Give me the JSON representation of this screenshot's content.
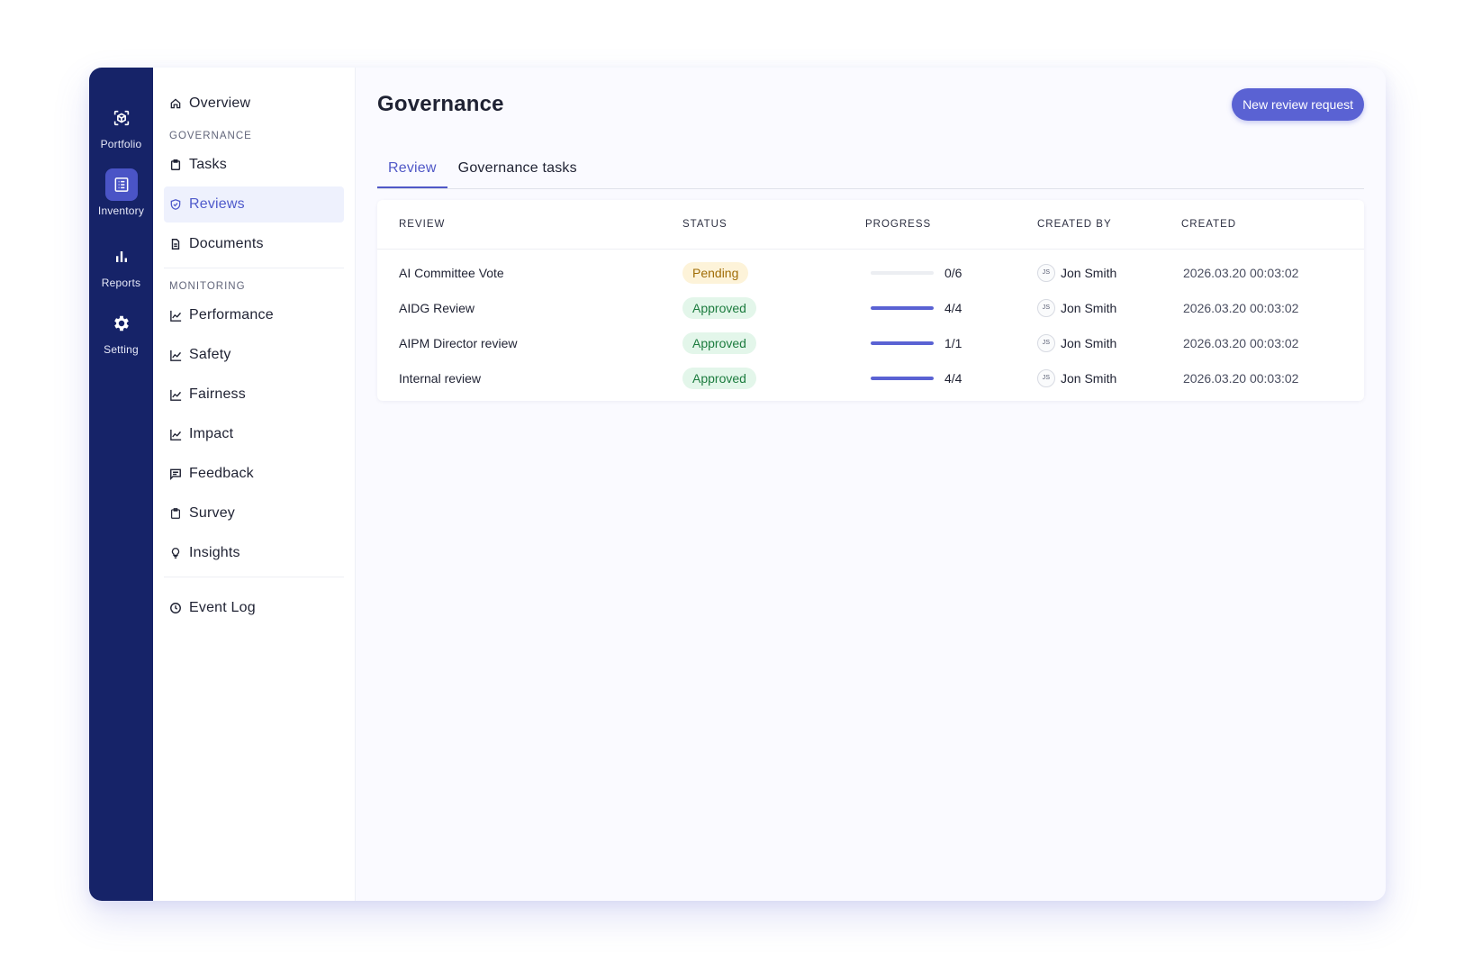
{
  "rail": {
    "items": [
      {
        "label": "Portfolio",
        "icon": "portfolio-icon"
      },
      {
        "label": "Inventory",
        "icon": "inventory-icon",
        "active": true
      },
      {
        "label": "Reports",
        "icon": "bar-chart-icon"
      },
      {
        "label": "Setting",
        "icon": "gear-icon"
      }
    ]
  },
  "nav": {
    "overview": "Overview",
    "governance_section": "GOVERNANCE",
    "tasks": "Tasks",
    "reviews": "Reviews",
    "documents": "Documents",
    "monitoring_section": "MONITORING",
    "performance": "Performance",
    "safety": "Safety",
    "fairness": "Fairness",
    "impact": "Impact",
    "feedback": "Feedback",
    "survey": "Survey",
    "insights": "Insights",
    "event_log": "Event Log"
  },
  "header": {
    "title": "Governance",
    "new_review_label": "New review request"
  },
  "tabs": [
    {
      "label": "Review",
      "active": true
    },
    {
      "label": "Governance tasks",
      "active": false
    }
  ],
  "table": {
    "columns": [
      "REVIEW",
      "STATUS",
      "PROGRESS",
      "CREATED BY",
      "CREATED"
    ],
    "rows": [
      {
        "review": "AI Committee Vote",
        "status": "Pending",
        "progress": "0/6",
        "progress_fraction": 0,
        "initials": "JS",
        "created_by": "Jon Smith",
        "created": "2026.03.20 00:03:02"
      },
      {
        "review": "AIDG Review",
        "status": "Approved",
        "progress": "4/4",
        "progress_fraction": 1,
        "initials": "JS",
        "created_by": "Jon Smith",
        "created": "2026.03.20 00:03:02"
      },
      {
        "review": "AIPM Director review",
        "status": "Approved",
        "progress": "1/1",
        "progress_fraction": 1,
        "initials": "JS",
        "created_by": "Jon Smith",
        "created": "2026.03.20 00:03:02"
      },
      {
        "review": "Internal review",
        "status": "Approved",
        "progress": "4/4",
        "progress_fraction": 1,
        "initials": "JS",
        "created_by": "Jon Smith",
        "created": "2026.03.20 00:03:02"
      }
    ]
  },
  "colors": {
    "rail_bg": "#162368",
    "accent": "#5a62d3",
    "pending_bg": "#fdf3d9",
    "approved_bg": "#e3f6ea"
  }
}
